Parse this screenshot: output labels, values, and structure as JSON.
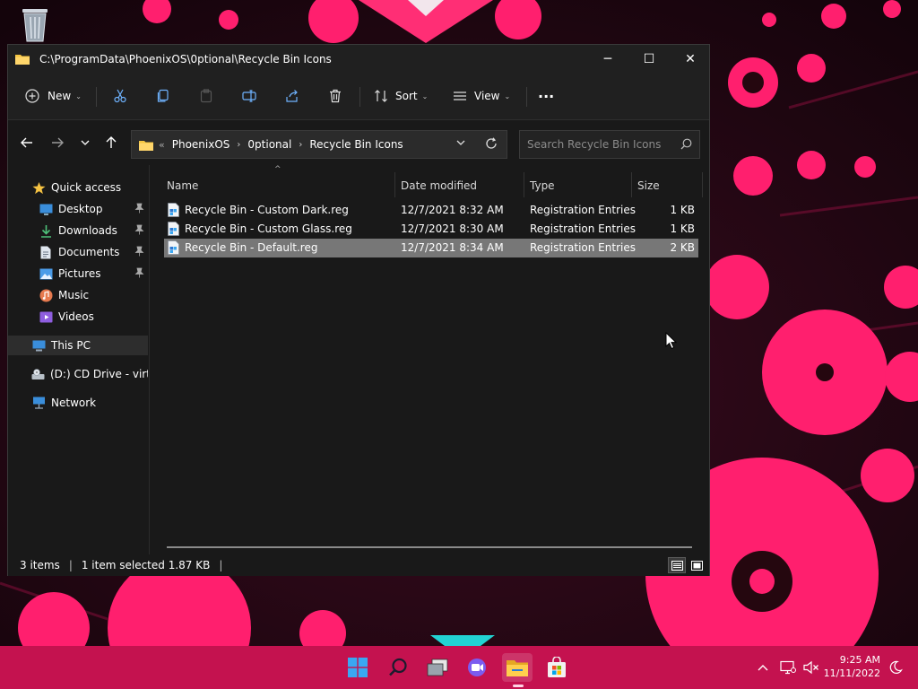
{
  "window": {
    "title": "C:\\ProgramData\\PhoenixOS\\0ptional\\Recycle Bin Icons",
    "controls": {
      "minimize": "─",
      "maximize": "☐",
      "close": "✕"
    }
  },
  "toolbar": {
    "new_label": "New",
    "sort_label": "Sort",
    "view_label": "View",
    "more_label": "···"
  },
  "address": {
    "prefix": "«",
    "segments": [
      "PhoenixOS",
      "0ptional",
      "Recycle Bin Icons"
    ],
    "separator": "›"
  },
  "search": {
    "placeholder": "Search Recycle Bin Icons"
  },
  "nav_pane": {
    "quick_access": "Quick access",
    "items": [
      {
        "label": "Desktop",
        "icon": "desktop-icon",
        "pinned": true
      },
      {
        "label": "Downloads",
        "icon": "downloads-icon",
        "pinned": true
      },
      {
        "label": "Documents",
        "icon": "documents-icon",
        "pinned": true
      },
      {
        "label": "Pictures",
        "icon": "pictures-icon",
        "pinned": true
      },
      {
        "label": "Music",
        "icon": "music-icon",
        "pinned": false
      },
      {
        "label": "Videos",
        "icon": "videos-icon",
        "pinned": false
      }
    ],
    "this_pc": "This PC",
    "cd_drive": "(D:) CD Drive - virtio-",
    "network": "Network"
  },
  "columns": {
    "name": "Name",
    "date": "Date modified",
    "type": "Type",
    "size": "Size"
  },
  "files": [
    {
      "name": "Recycle Bin - Custom Dark.reg",
      "date": "12/7/2021 8:32 AM",
      "type": "Registration Entries",
      "size": "1 KB",
      "selected": false
    },
    {
      "name": "Recycle Bin - Custom Glass.reg",
      "date": "12/7/2021 8:30 AM",
      "type": "Registration Entries",
      "size": "1 KB",
      "selected": false
    },
    {
      "name": "Recycle Bin - Default.reg",
      "date": "12/7/2021 8:34 AM",
      "type": "Registration Entries",
      "size": "2 KB",
      "selected": true
    }
  ],
  "status": {
    "items_count": "3 items",
    "selection": "1 item selected  1.87 KB",
    "divider": "|"
  },
  "taskbar": {
    "time": "9:25 AM",
    "date": "11/11/2022"
  },
  "colors": {
    "taskbar": "#c4124f",
    "wallpaper_accent": "#ff1f6e",
    "window_bg": "#191919",
    "selection": "#777777"
  }
}
